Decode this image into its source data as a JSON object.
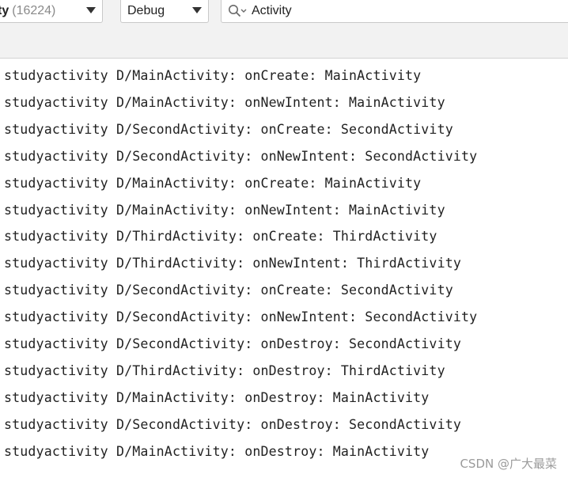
{
  "toolbar": {
    "process": {
      "name": "ty",
      "pid": "(16224)"
    },
    "log_level": {
      "selected": "Debug"
    },
    "search": {
      "value": "Activity"
    }
  },
  "log": {
    "lines": [
      "studyactivity D/MainActivity: onCreate: MainActivity",
      "studyactivity D/MainActivity: onNewIntent: MainActivity",
      "studyactivity D/SecondActivity: onCreate: SecondActivity",
      "studyactivity D/SecondActivity: onNewIntent: SecondActivity",
      "studyactivity D/MainActivity: onCreate: MainActivity",
      "studyactivity D/MainActivity: onNewIntent: MainActivity",
      "studyactivity D/ThirdActivity: onCreate: ThirdActivity",
      "studyactivity D/ThirdActivity: onNewIntent: ThirdActivity",
      "studyactivity D/SecondActivity: onCreate: SecondActivity",
      "studyactivity D/SecondActivity: onNewIntent: SecondActivity",
      "studyactivity D/SecondActivity: onDestroy: SecondActivity",
      "studyactivity D/ThirdActivity: onDestroy: ThirdActivity",
      "studyactivity D/MainActivity: onDestroy: MainActivity",
      "studyactivity D/SecondActivity: onDestroy: SecondActivity",
      "studyactivity D/MainActivity: onDestroy: MainActivity"
    ]
  },
  "watermark": "CSDN @广大最菜"
}
